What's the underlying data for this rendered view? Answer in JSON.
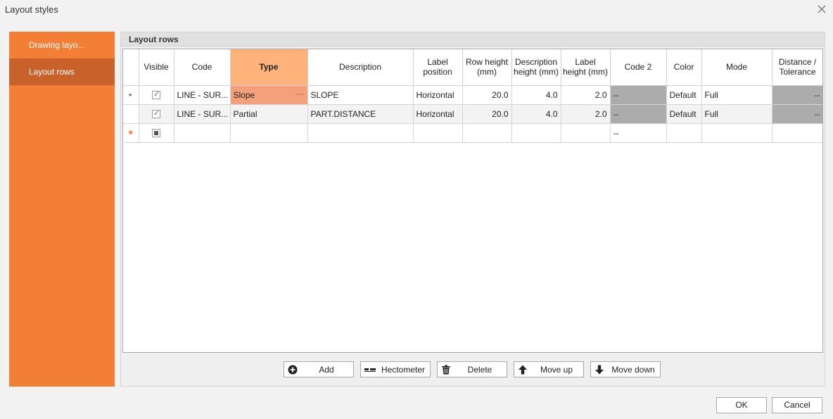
{
  "window": {
    "title": "Layout styles"
  },
  "sidebar": {
    "items": [
      {
        "label": "Drawing layo..."
      },
      {
        "label": "Layout rows"
      }
    ]
  },
  "panel": {
    "title": "Layout rows"
  },
  "grid": {
    "columns": [
      {
        "label": "Visible"
      },
      {
        "label": "Code"
      },
      {
        "label": "Type"
      },
      {
        "label": "Description"
      },
      {
        "label": "Label position"
      },
      {
        "label": "Row height (mm)"
      },
      {
        "label": "Description height (mm)"
      },
      {
        "label": "Label height (mm)"
      },
      {
        "label": "Code 2"
      },
      {
        "label": "Color"
      },
      {
        "label": "Mode"
      },
      {
        "label": "Distance / Tolerance"
      }
    ],
    "rows": [
      {
        "visible": true,
        "code": "LINE - SUR...",
        "type": "Slope",
        "description": "SLOPE",
        "label_position": "Horizontal",
        "row_height": "20.0",
        "description_height": "4.0",
        "label_height": "2.0",
        "code2": "--",
        "color": "Default",
        "mode": "Full",
        "distance": "--"
      },
      {
        "visible": true,
        "code": "LINE - SUR...",
        "type": "Partial",
        "description": "PART.DISTANCE",
        "label_position": "Horizontal",
        "row_height": "20.0",
        "description_height": "4.0",
        "label_height": "2.0",
        "code2": "--",
        "color": "Default",
        "mode": "Full",
        "distance": "--"
      }
    ],
    "new_row": {
      "code2": "--"
    },
    "type_editor_button": "···"
  },
  "toolbar": {
    "add": "Add",
    "hectometer": "Hectometer",
    "delete": "Delete",
    "move_up": "Move up",
    "move_down": "Move down"
  },
  "footer": {
    "ok": "OK",
    "cancel": "Cancel"
  },
  "colors": {
    "accent": "#f37f36",
    "accent_dark": "#c9622a",
    "selected_header": "#ffb37a",
    "selected_cell": "#f4a07a",
    "disabled_cell": "#acacac"
  }
}
